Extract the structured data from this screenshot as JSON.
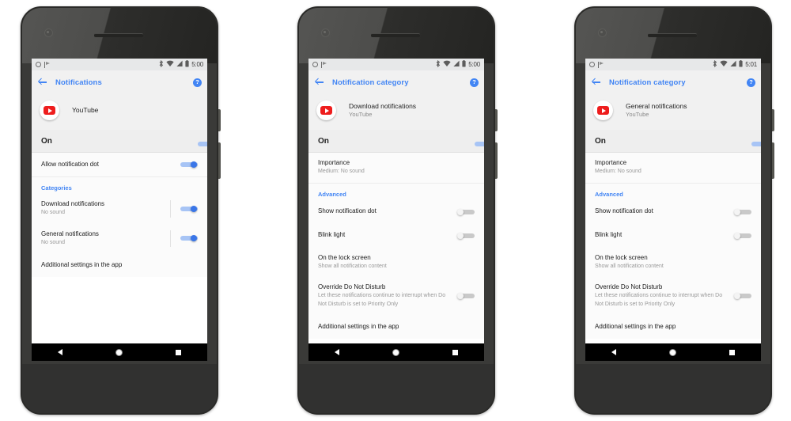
{
  "phones": [
    {
      "id": "phone-notifications",
      "status_bar": {
        "left_icons": [
          "dnd-circle-icon",
          "flag-icon"
        ],
        "right_icons": [
          "bluetooth-icon",
          "wifi-icon",
          "signal-icon",
          "battery-icon"
        ],
        "time": "5:00"
      },
      "appbar": {
        "title": "Notifications",
        "back_icon": "back-arrow-icon",
        "help_icon": "help-icon",
        "help_glyph": "?"
      },
      "app_header": {
        "icon": "youtube-icon",
        "title": "YouTube",
        "subtitle": ""
      },
      "master_switch": {
        "label": "On",
        "state": "on"
      },
      "rows": [
        {
          "type": "switch",
          "title": "Allow notification dot",
          "subtitle": "",
          "state": "on",
          "divider": true
        },
        {
          "type": "section",
          "title": "Categories"
        },
        {
          "type": "switch-divided",
          "title": "Download notifications",
          "subtitle": "No sound",
          "state": "on"
        },
        {
          "type": "switch-divided",
          "title": "General notifications",
          "subtitle": "No sound",
          "state": "on"
        },
        {
          "type": "plain",
          "title": "Additional settings in the app",
          "subtitle": ""
        }
      ],
      "navbar": {
        "back": "nav-back-icon",
        "home": "nav-home-icon",
        "recents": "nav-recents-icon"
      }
    },
    {
      "id": "phone-download-category",
      "status_bar": {
        "left_icons": [
          "dnd-circle-icon",
          "flag-icon"
        ],
        "right_icons": [
          "bluetooth-icon",
          "wifi-icon",
          "signal-icon",
          "battery-icon"
        ],
        "time": "5:00"
      },
      "appbar": {
        "title": "Notification category",
        "back_icon": "back-arrow-icon",
        "help_icon": "help-icon",
        "help_glyph": "?"
      },
      "app_header": {
        "icon": "youtube-icon",
        "title": "Download notifications",
        "subtitle": "YouTube"
      },
      "master_switch": {
        "label": "On",
        "state": "on"
      },
      "rows": [
        {
          "type": "plain",
          "title": "Importance",
          "subtitle": "Medium: No sound",
          "divider": true
        },
        {
          "type": "section",
          "title": "Advanced"
        },
        {
          "type": "switch",
          "title": "Show notification dot",
          "subtitle": "",
          "state": "off"
        },
        {
          "type": "switch",
          "title": "Blink light",
          "subtitle": "",
          "state": "off"
        },
        {
          "type": "plain",
          "title": "On the lock screen",
          "subtitle": "Show all notification content"
        },
        {
          "type": "switch",
          "title": "Override Do Not Disturb",
          "subtitle": "Let these notifications continue to interrupt when Do Not Disturb is set to Priority Only",
          "state": "off"
        },
        {
          "type": "plain",
          "title": "Additional settings in the app",
          "subtitle": ""
        }
      ],
      "navbar": {
        "back": "nav-back-icon",
        "home": "nav-home-icon",
        "recents": "nav-recents-icon"
      }
    },
    {
      "id": "phone-general-category",
      "status_bar": {
        "left_icons": [
          "dnd-circle-icon",
          "flag-icon"
        ],
        "right_icons": [
          "bluetooth-icon",
          "wifi-icon",
          "signal-icon",
          "battery-icon"
        ],
        "time": "5:01"
      },
      "appbar": {
        "title": "Notification category",
        "back_icon": "back-arrow-icon",
        "help_icon": "help-icon",
        "help_glyph": "?"
      },
      "app_header": {
        "icon": "youtube-icon",
        "title": "General notifications",
        "subtitle": "YouTube"
      },
      "master_switch": {
        "label": "On",
        "state": "on"
      },
      "rows": [
        {
          "type": "plain",
          "title": "Importance",
          "subtitle": "Medium: No sound",
          "divider": true
        },
        {
          "type": "section",
          "title": "Advanced"
        },
        {
          "type": "switch",
          "title": "Show notification dot",
          "subtitle": "",
          "state": "off"
        },
        {
          "type": "switch",
          "title": "Blink light",
          "subtitle": "",
          "state": "off"
        },
        {
          "type": "plain",
          "title": "On the lock screen",
          "subtitle": "Show all notification content"
        },
        {
          "type": "switch",
          "title": "Override Do Not Disturb",
          "subtitle": "Let these notifications continue to interrupt when Do Not Disturb is set to Priority Only",
          "state": "off"
        },
        {
          "type": "plain",
          "title": "Additional settings in the app",
          "subtitle": ""
        }
      ],
      "navbar": {
        "back": "nav-back-icon",
        "home": "nav-home-icon",
        "recents": "nav-recents-icon"
      }
    }
  ],
  "colors": {
    "accent_blue": "#4285f4",
    "toggle_on": "#3a76e8",
    "toggle_on_track": "#a7c4f5",
    "toggle_off": "#c9c9c9",
    "youtube_red": "#ee1d1d",
    "page_background": "#ffffff",
    "phone_body": "#3a3a38",
    "header_background": "#f1f1f1",
    "master_row_background": "#eeeeee"
  }
}
